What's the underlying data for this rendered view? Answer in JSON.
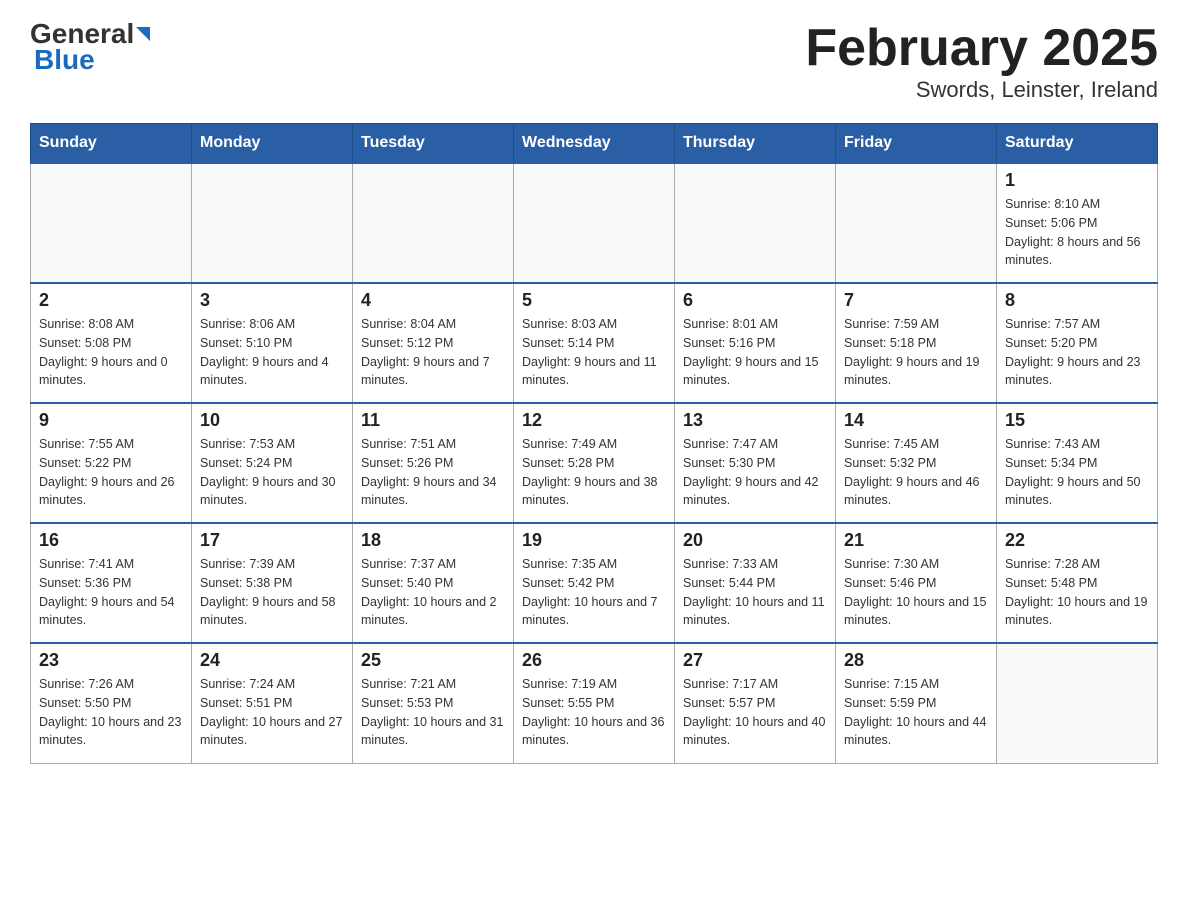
{
  "header": {
    "logo_main": "General",
    "logo_sub": "Blue",
    "title": "February 2025",
    "subtitle": "Swords, Leinster, Ireland"
  },
  "days_of_week": [
    "Sunday",
    "Monday",
    "Tuesday",
    "Wednesday",
    "Thursday",
    "Friday",
    "Saturday"
  ],
  "weeks": [
    [
      {
        "day": "",
        "info": ""
      },
      {
        "day": "",
        "info": ""
      },
      {
        "day": "",
        "info": ""
      },
      {
        "day": "",
        "info": ""
      },
      {
        "day": "",
        "info": ""
      },
      {
        "day": "",
        "info": ""
      },
      {
        "day": "1",
        "info": "Sunrise: 8:10 AM\nSunset: 5:06 PM\nDaylight: 8 hours and 56 minutes."
      }
    ],
    [
      {
        "day": "2",
        "info": "Sunrise: 8:08 AM\nSunset: 5:08 PM\nDaylight: 9 hours and 0 minutes."
      },
      {
        "day": "3",
        "info": "Sunrise: 8:06 AM\nSunset: 5:10 PM\nDaylight: 9 hours and 4 minutes."
      },
      {
        "day": "4",
        "info": "Sunrise: 8:04 AM\nSunset: 5:12 PM\nDaylight: 9 hours and 7 minutes."
      },
      {
        "day": "5",
        "info": "Sunrise: 8:03 AM\nSunset: 5:14 PM\nDaylight: 9 hours and 11 minutes."
      },
      {
        "day": "6",
        "info": "Sunrise: 8:01 AM\nSunset: 5:16 PM\nDaylight: 9 hours and 15 minutes."
      },
      {
        "day": "7",
        "info": "Sunrise: 7:59 AM\nSunset: 5:18 PM\nDaylight: 9 hours and 19 minutes."
      },
      {
        "day": "8",
        "info": "Sunrise: 7:57 AM\nSunset: 5:20 PM\nDaylight: 9 hours and 23 minutes."
      }
    ],
    [
      {
        "day": "9",
        "info": "Sunrise: 7:55 AM\nSunset: 5:22 PM\nDaylight: 9 hours and 26 minutes."
      },
      {
        "day": "10",
        "info": "Sunrise: 7:53 AM\nSunset: 5:24 PM\nDaylight: 9 hours and 30 minutes."
      },
      {
        "day": "11",
        "info": "Sunrise: 7:51 AM\nSunset: 5:26 PM\nDaylight: 9 hours and 34 minutes."
      },
      {
        "day": "12",
        "info": "Sunrise: 7:49 AM\nSunset: 5:28 PM\nDaylight: 9 hours and 38 minutes."
      },
      {
        "day": "13",
        "info": "Sunrise: 7:47 AM\nSunset: 5:30 PM\nDaylight: 9 hours and 42 minutes."
      },
      {
        "day": "14",
        "info": "Sunrise: 7:45 AM\nSunset: 5:32 PM\nDaylight: 9 hours and 46 minutes."
      },
      {
        "day": "15",
        "info": "Sunrise: 7:43 AM\nSunset: 5:34 PM\nDaylight: 9 hours and 50 minutes."
      }
    ],
    [
      {
        "day": "16",
        "info": "Sunrise: 7:41 AM\nSunset: 5:36 PM\nDaylight: 9 hours and 54 minutes."
      },
      {
        "day": "17",
        "info": "Sunrise: 7:39 AM\nSunset: 5:38 PM\nDaylight: 9 hours and 58 minutes."
      },
      {
        "day": "18",
        "info": "Sunrise: 7:37 AM\nSunset: 5:40 PM\nDaylight: 10 hours and 2 minutes."
      },
      {
        "day": "19",
        "info": "Sunrise: 7:35 AM\nSunset: 5:42 PM\nDaylight: 10 hours and 7 minutes."
      },
      {
        "day": "20",
        "info": "Sunrise: 7:33 AM\nSunset: 5:44 PM\nDaylight: 10 hours and 11 minutes."
      },
      {
        "day": "21",
        "info": "Sunrise: 7:30 AM\nSunset: 5:46 PM\nDaylight: 10 hours and 15 minutes."
      },
      {
        "day": "22",
        "info": "Sunrise: 7:28 AM\nSunset: 5:48 PM\nDaylight: 10 hours and 19 minutes."
      }
    ],
    [
      {
        "day": "23",
        "info": "Sunrise: 7:26 AM\nSunset: 5:50 PM\nDaylight: 10 hours and 23 minutes."
      },
      {
        "day": "24",
        "info": "Sunrise: 7:24 AM\nSunset: 5:51 PM\nDaylight: 10 hours and 27 minutes."
      },
      {
        "day": "25",
        "info": "Sunrise: 7:21 AM\nSunset: 5:53 PM\nDaylight: 10 hours and 31 minutes."
      },
      {
        "day": "26",
        "info": "Sunrise: 7:19 AM\nSunset: 5:55 PM\nDaylight: 10 hours and 36 minutes."
      },
      {
        "day": "27",
        "info": "Sunrise: 7:17 AM\nSunset: 5:57 PM\nDaylight: 10 hours and 40 minutes."
      },
      {
        "day": "28",
        "info": "Sunrise: 7:15 AM\nSunset: 5:59 PM\nDaylight: 10 hours and 44 minutes."
      },
      {
        "day": "",
        "info": ""
      }
    ]
  ]
}
